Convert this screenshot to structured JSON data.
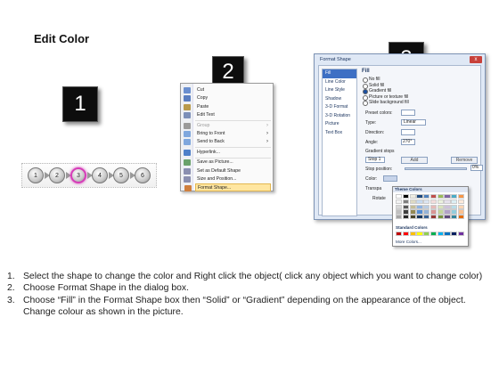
{
  "page": {
    "title": "Edit Color"
  },
  "steps": [
    "1",
    "2",
    "3"
  ],
  "chain": {
    "nodes": [
      "1",
      "2",
      "3",
      "4",
      "5",
      "6"
    ],
    "selected_index": 2,
    "selected_color": "#d63cb8"
  },
  "context_menu": {
    "items": [
      {
        "label": "Cut",
        "icon": "scissors-icon"
      },
      {
        "label": "Copy",
        "icon": "copy-icon"
      },
      {
        "label": "Paste",
        "icon": "paste-icon"
      },
      {
        "label": "Edit Text",
        "icon": "edit-text-icon"
      },
      {
        "label": "Group",
        "icon": "group-icon",
        "disabled": true,
        "submenu": true
      },
      {
        "label": "Bring to Front",
        "icon": "bring-front-icon",
        "submenu": true
      },
      {
        "label": "Send to Back",
        "icon": "send-back-icon",
        "submenu": true
      },
      {
        "label": "Hyperlink...",
        "icon": "hyperlink-icon"
      },
      {
        "label": "Save as Picture...",
        "icon": "save-picture-icon"
      },
      {
        "label": "Set as Default Shape",
        "icon": "default-shape-icon"
      },
      {
        "label": "Size and Position...",
        "icon": "size-position-icon"
      },
      {
        "label": "Format Shape...",
        "icon": "format-shape-icon",
        "highlighted": true
      }
    ]
  },
  "dialog": {
    "title": "Format Shape",
    "close_label": "x",
    "categories": [
      "Fill",
      "Line Color",
      "Line Style",
      "Shadow",
      "3-D Format",
      "3-D Rotation",
      "Picture",
      "Text Box"
    ],
    "active_category": "Fill",
    "pane_heading": "Fill",
    "fill_options": [
      {
        "label": "No fill",
        "on": false
      },
      {
        "label": "Solid fill",
        "on": false
      },
      {
        "label": "Gradient fill",
        "on": true
      },
      {
        "label": "Picture or texture fill",
        "on": false
      },
      {
        "label": "Slide background fill",
        "on": false
      }
    ],
    "preset_label": "Preset colors:",
    "type_label": "Type:",
    "type_value": "Linear",
    "direction_label": "Direction:",
    "angle_label": "Angle:",
    "angle_value": "270°",
    "gradient_stops_label": "Gradient stops",
    "stop_value": "Stop 1",
    "add_label": "Add",
    "remove_label": "Remove",
    "stop_position_label": "Stop position:",
    "stop_position_value": "0%",
    "color_label": "Color:",
    "transparency_label": "Transpa",
    "rotate_label": "Rotate"
  },
  "palette": {
    "theme_label": "Theme Colors",
    "standard_label": "Standard Colors",
    "more_label": "More Colors...",
    "theme_top": [
      "#ffffff",
      "#000000",
      "#eeece1",
      "#1f497d",
      "#4f81bd",
      "#c0504d",
      "#9bbb59",
      "#8064a2",
      "#4bacc6",
      "#f79646"
    ],
    "theme_shades": [
      [
        "#f2f2f2",
        "#7f7f7f",
        "#ddd9c3",
        "#c6d9f0",
        "#dbe5f1",
        "#f2dcdb",
        "#ebf1dd",
        "#e5e0ec",
        "#dbeef3",
        "#fdeada"
      ],
      [
        "#d8d8d8",
        "#595959",
        "#c4bd97",
        "#8db3e2",
        "#b8cce4",
        "#e5b9b7",
        "#d7e3bc",
        "#ccc1d9",
        "#b7dde8",
        "#fbd5b5"
      ],
      [
        "#bfbfbf",
        "#3f3f3f",
        "#938953",
        "#548dd4",
        "#95b3d7",
        "#d99694",
        "#c3d69b",
        "#b2a2c7",
        "#92cddc",
        "#fac08f"
      ],
      [
        "#a5a5a5",
        "#262626",
        "#494429",
        "#17365d",
        "#366092",
        "#953734",
        "#76923c",
        "#5f497a",
        "#31859b",
        "#e36c09"
      ]
    ],
    "standard": [
      "#c00000",
      "#ff0000",
      "#ffc000",
      "#ffff00",
      "#92d050",
      "#00b050",
      "#00b0f0",
      "#0070c0",
      "#002060",
      "#7030a0"
    ]
  },
  "instructions": [
    {
      "num": "1.",
      "text": "Select the shape to change the color and Right click the object( click any object which you want to change color)"
    },
    {
      "num": "2.",
      "text": "Choose Format Shape in the dialog box."
    },
    {
      "num": "3.",
      "text": "Choose “Fill” in the Format Shape box then “Solid” or “Gradient” depending on the appearance of the object. Change colour as shown in the picture."
    }
  ]
}
